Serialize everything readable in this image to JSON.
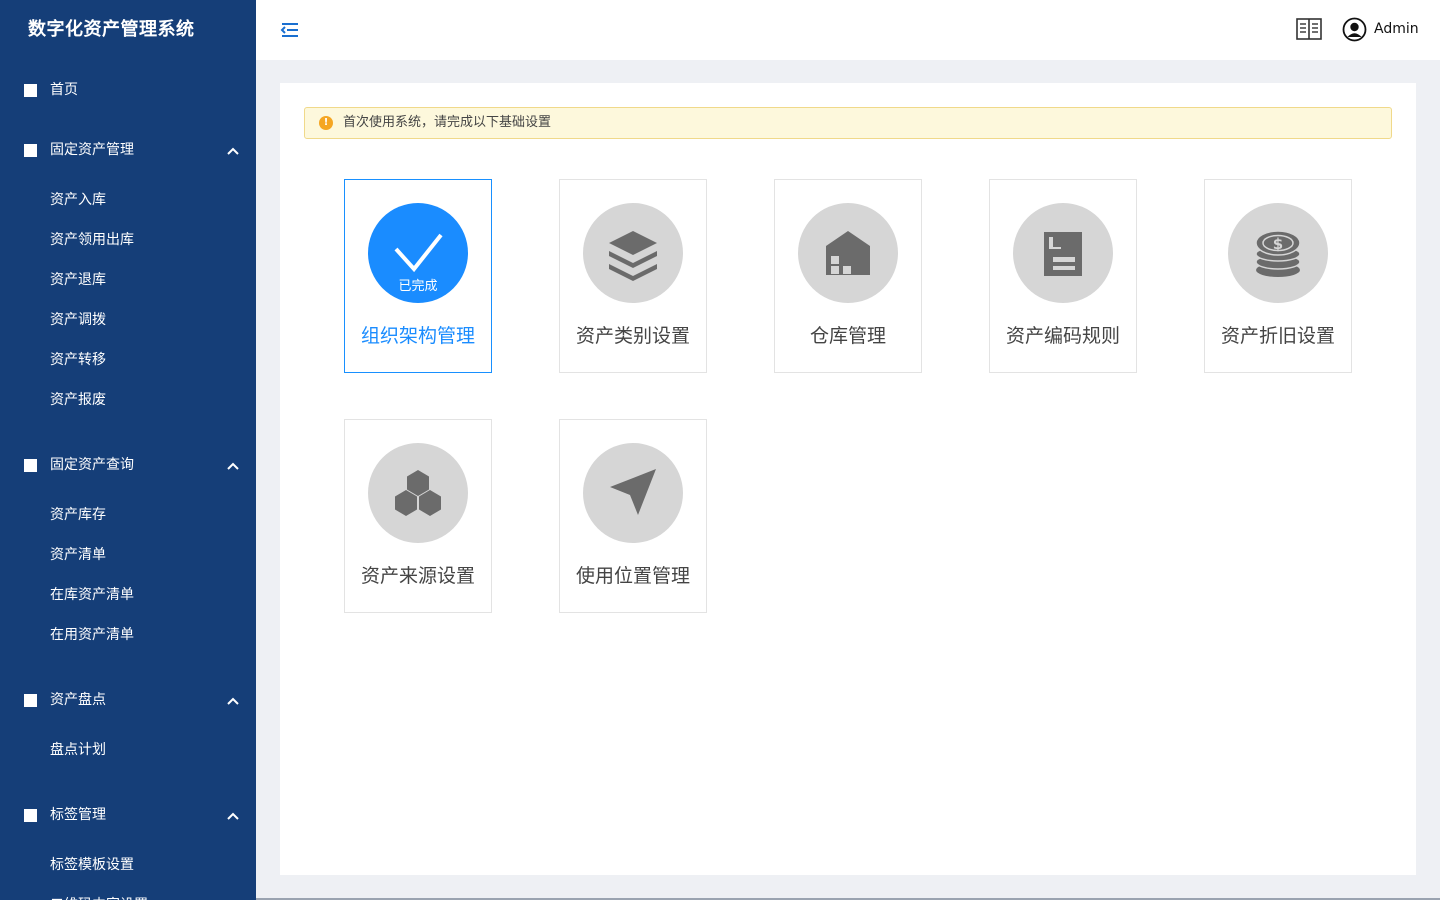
{
  "app": {
    "title": "数字化资产管理系统"
  },
  "sidebar": {
    "home": "首页",
    "groups": [
      {
        "label": "固定资产管理",
        "items": [
          "资产入库",
          "资产领用出库",
          "资产退库",
          "资产调拨",
          "资产转移",
          "资产报废"
        ]
      },
      {
        "label": "固定资产查询",
        "items": [
          "资产库存",
          "资产清单",
          "在库资产清单",
          "在用资产清单"
        ]
      },
      {
        "label": "资产盘点",
        "items": [
          "盘点计划"
        ]
      },
      {
        "label": "标签管理",
        "items": [
          "标签模板设置",
          "二维码内容设置"
        ]
      }
    ]
  },
  "header": {
    "user": "Admin",
    "icons": [
      "menu-fold-icon",
      "book-icon",
      "user-icon"
    ]
  },
  "alert": {
    "icon": "!",
    "text": "首次使用系统，请完成以下基础设置"
  },
  "colors": {
    "sidebar": "#153e78",
    "accent": "#1a8cff",
    "alert_bg": "#fdf8dc",
    "alert_icon": "#f5a623"
  },
  "cards": [
    {
      "title": "组织架构管理",
      "status": "已完成",
      "active": true,
      "icon": "checkmark-icon"
    },
    {
      "title": "资产类别设置",
      "icon": "layers-icon"
    },
    {
      "title": "仓库管理",
      "icon": "warehouse-icon"
    },
    {
      "title": "资产编码规则",
      "icon": "document-icon"
    },
    {
      "title": "资产折旧设置",
      "icon": "coins-icon"
    },
    {
      "title": "资产来源设置",
      "icon": "hexagons-icon"
    },
    {
      "title": "使用位置管理",
      "icon": "location-arrow-icon"
    }
  ]
}
